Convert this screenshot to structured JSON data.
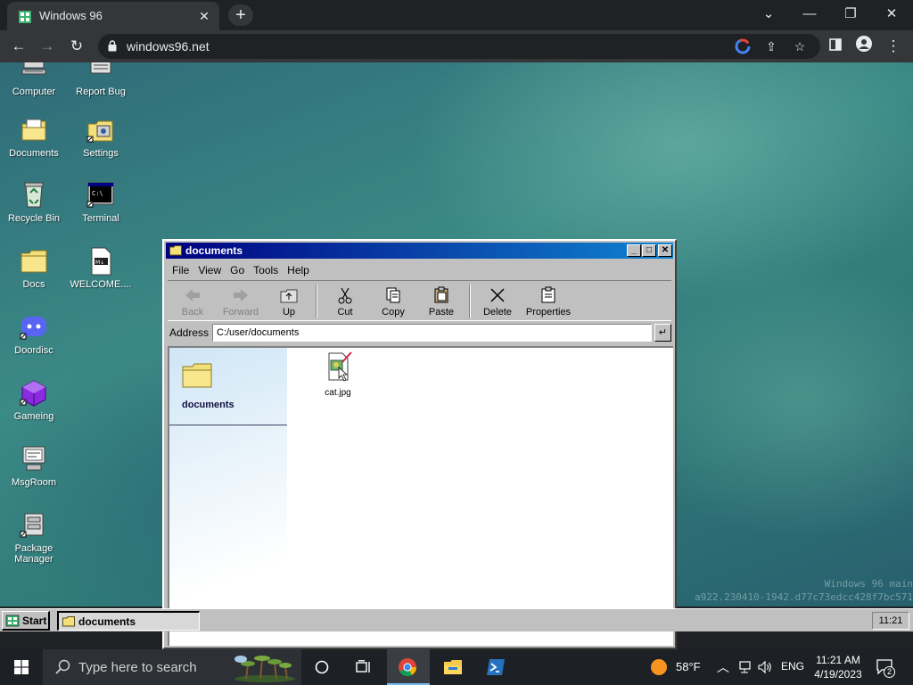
{
  "browser": {
    "tab_title": "Windows 96",
    "url": "windows96.net",
    "tab_close": "✕",
    "new_tab": "+"
  },
  "desktop": {
    "icons": [
      {
        "label": "Computer"
      },
      {
        "label": "Report Bug"
      },
      {
        "label": "Documents"
      },
      {
        "label": "Settings"
      },
      {
        "label": "Recycle Bin"
      },
      {
        "label": "Terminal"
      },
      {
        "label": "Docs"
      },
      {
        "label": "WELCOME...."
      },
      {
        "label": "Doordisc"
      },
      {
        "label": "Gameing"
      },
      {
        "label": "MsgRoom"
      },
      {
        "label": "Package Manager"
      }
    ],
    "watermark_line1": "Windows 96 main",
    "watermark_line2": "a922.230410-1942.d77c73edcc428f7bc571"
  },
  "window": {
    "title": "documents",
    "menu": [
      "File",
      "View",
      "Go",
      "Tools",
      "Help"
    ],
    "toolbar": {
      "back": "Back",
      "forward": "Forward",
      "up": "Up",
      "cut": "Cut",
      "copy": "Copy",
      "paste": "Paste",
      "delete": "Delete",
      "properties": "Properties"
    },
    "address_label": "Address",
    "address_value": "C:/user/documents",
    "webview_title": "documents",
    "files": [
      {
        "name": "cat.jpg",
        "icon": "image-file-icon"
      }
    ]
  },
  "w96_taskbar": {
    "start_label": "Start",
    "task_label": "documents",
    "clock": "11:21"
  },
  "win_taskbar": {
    "search_placeholder": "Type here to search",
    "temperature": "58°F",
    "language": "ENG",
    "time": "11:21 AM",
    "date": "4/19/2023",
    "notifications": "2"
  },
  "colors": {
    "titlebar_start": "#000080",
    "titlebar_end": "#1084d0",
    "face": "#c0c0c0",
    "chrome_dark": "#202124"
  }
}
